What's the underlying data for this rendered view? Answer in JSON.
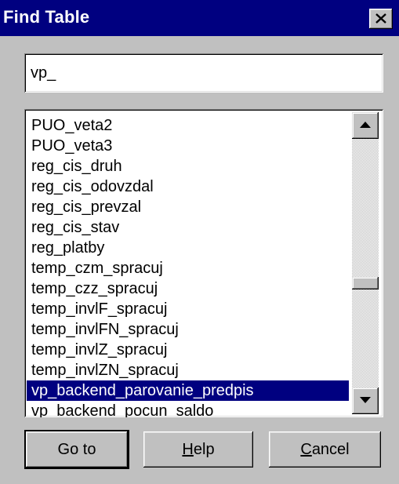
{
  "dialog": {
    "title": "Find Table"
  },
  "search": {
    "value": "vp_"
  },
  "list": {
    "items": [
      "PUO_veta2",
      "PUO_veta3",
      "reg_cis_druh",
      "reg_cis_odovzdal",
      "reg_cis_prevzal",
      "reg_cis_stav",
      "reg_platby",
      "temp_czm_spracuj",
      "temp_czz_spracuj",
      "temp_invlF_spracuj",
      "temp_invlFN_spracuj",
      "temp_invlZ_spracuj",
      "temp_invlZN_spracuj",
      "vp_backend_parovanie_predpis",
      "vp_backend_pocun_saldo"
    ],
    "selected_index": 13
  },
  "buttons": {
    "goto": "Go to",
    "help_mnemonic": "H",
    "help_rest": "elp",
    "cancel_mnemonic": "C",
    "cancel_rest": "ancel"
  },
  "colors": {
    "titlebar": "#000080",
    "selection": "#000080",
    "face": "#c0c0c0"
  },
  "icons": {
    "close": "close-icon",
    "scroll_up": "arrow-up-icon",
    "scroll_down": "arrow-down-icon"
  }
}
